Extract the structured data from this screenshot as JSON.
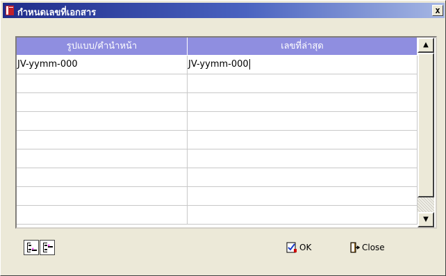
{
  "window": {
    "title": "กำหนดเลขที่เอกสาร",
    "close_glyph": "x"
  },
  "table": {
    "columns": [
      "รูปแบบ/คำนำหน้า",
      "เลขที่ล่าสุด"
    ],
    "rows": [
      [
        "JV-yymm-000",
        "JV-yymm-000"
      ],
      [
        "",
        ""
      ],
      [
        "",
        ""
      ],
      [
        "",
        ""
      ],
      [
        "",
        ""
      ],
      [
        "",
        ""
      ],
      [
        "",
        ""
      ],
      [
        "",
        ""
      ],
      [
        "",
        ""
      ]
    ]
  },
  "scrollbar": {
    "up_glyph": "▲",
    "down_glyph": "▼"
  },
  "toolbar": {
    "insert_row_icon": "insert-row-icon",
    "delete_row_icon": "delete-row-icon"
  },
  "buttons": {
    "ok_label": "OK",
    "close_label": "Close"
  },
  "colors": {
    "header_bg": "#8f8ee0",
    "title_bar_start": "#1f2c8a",
    "title_bar_end": "#a6b7e4",
    "window_bg": "#ece9d8"
  }
}
